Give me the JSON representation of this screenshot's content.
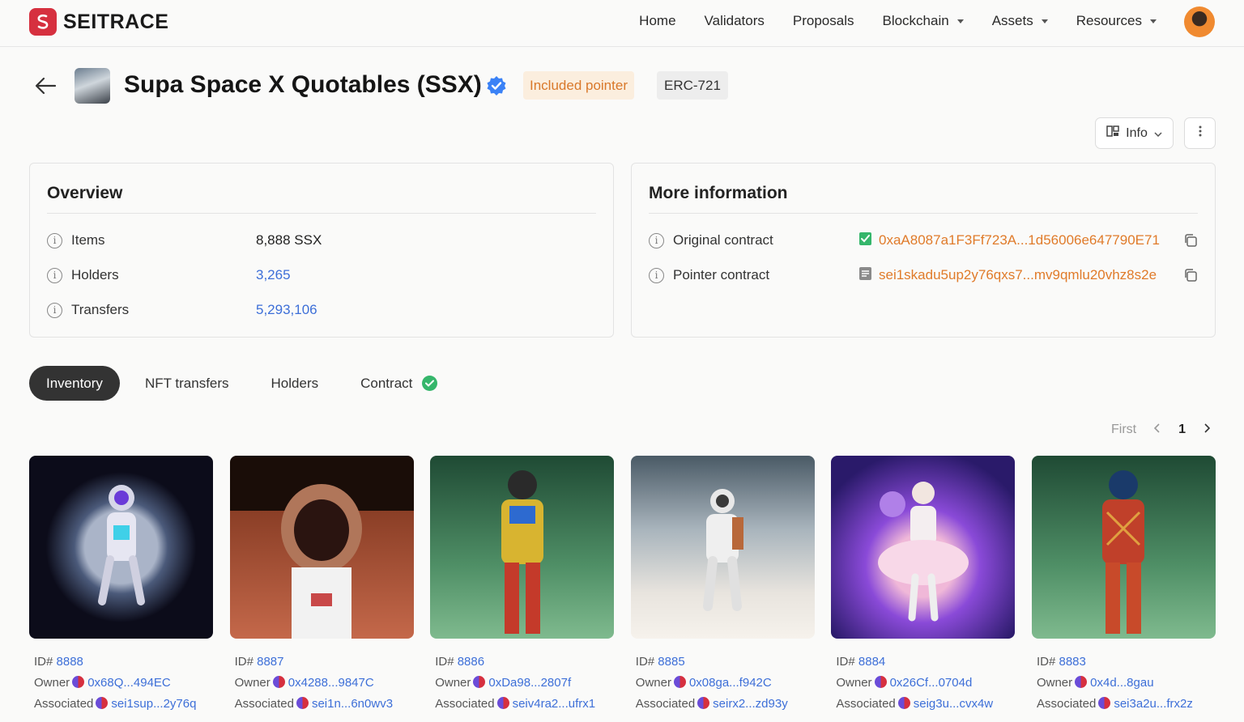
{
  "header": {
    "brand": "SEITRACE",
    "nav": [
      {
        "label": "Home",
        "dropdown": false
      },
      {
        "label": "Validators",
        "dropdown": false
      },
      {
        "label": "Proposals",
        "dropdown": false
      },
      {
        "label": "Blockchain",
        "dropdown": true
      },
      {
        "label": "Assets",
        "dropdown": true
      },
      {
        "label": "Resources",
        "dropdown": true
      }
    ]
  },
  "token": {
    "title": "Supa Space X Quotables (SSX)",
    "badge_pointer": "Included pointer",
    "badge_standard": "ERC-721"
  },
  "actions": {
    "info_label": "Info"
  },
  "overview": {
    "title": "Overview",
    "rows": [
      {
        "label": "Items",
        "value": "8,888 SSX"
      },
      {
        "label": "Holders",
        "value": "3,265"
      },
      {
        "label": "Transfers",
        "value": "5,293,106"
      }
    ]
  },
  "more_info": {
    "title": "More information",
    "rows": [
      {
        "label": "Original contract",
        "value": "0xaA8087a1F3Ff723A...1d56006e647790E71"
      },
      {
        "label": "Pointer contract",
        "value": "sei1skadu5up2y76qxs7...mv9qmlu20vhz8s2e"
      }
    ]
  },
  "tabs": [
    {
      "label": "Inventory",
      "active": true
    },
    {
      "label": "NFT transfers",
      "active": false
    },
    {
      "label": "Holders",
      "active": false
    },
    {
      "label": "Contract",
      "active": false
    }
  ],
  "pagination": {
    "first": "First",
    "page": "1"
  },
  "nfts": [
    {
      "id_label": "ID#",
      "id": "8888",
      "owner_label": "Owner",
      "owner": "0x68Q...494EC",
      "assoc_label": "Associated",
      "assoc": "sei1sup...2y76q"
    },
    {
      "id_label": "ID#",
      "id": "8887",
      "owner_label": "Owner",
      "owner": "0x4288...9847C",
      "assoc_label": "Associated",
      "assoc": "sei1n...6n0wv3"
    },
    {
      "id_label": "ID#",
      "id": "8886",
      "owner_label": "Owner",
      "owner": "0xDa98...2807f",
      "assoc_label": "Associated",
      "assoc": "seiv4ra2...ufrx1"
    },
    {
      "id_label": "ID#",
      "id": "8885",
      "owner_label": "Owner",
      "owner": "0x08ga...f942C",
      "assoc_label": "Associated",
      "assoc": "seirx2...zd93y"
    },
    {
      "id_label": "ID#",
      "id": "8884",
      "owner_label": "Owner",
      "owner": "0x26Cf...0704d",
      "assoc_label": "Associated",
      "assoc": "seig3u...cvx4w"
    },
    {
      "id_label": "ID#",
      "id": "8883",
      "owner_label": "Owner",
      "owner": "0x4d...8gau",
      "assoc_label": "Associated",
      "assoc": "sei3a2u...frx2z"
    }
  ],
  "colors": {
    "brand": "#d6303f",
    "link": "#3d6fd8",
    "pointer_badge_text": "#d9782a",
    "verified": "#3b82f6",
    "success": "#35b66b"
  }
}
